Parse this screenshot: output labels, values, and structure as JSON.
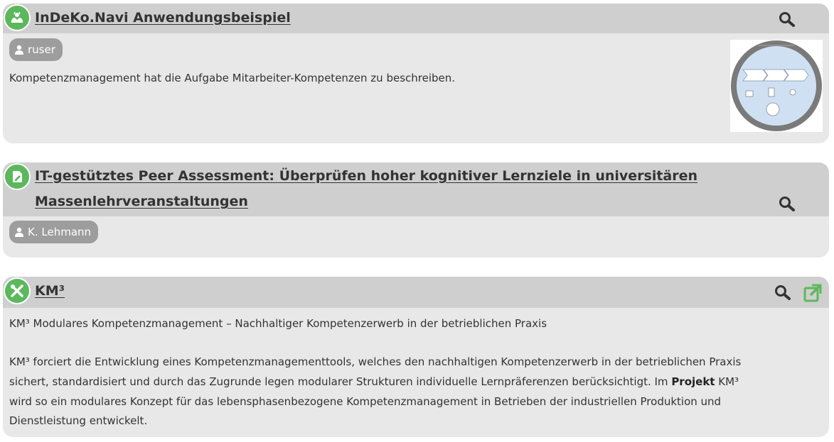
{
  "entries": [
    {
      "title": "InDeKo.Navi Anwendungsbeispiel",
      "author": "ruser",
      "description": "Kompetenzmanagement hat die Aufgabe Mitarbeiter-Kompetenzen zu beschreiben.",
      "type_icon": "hands-icon",
      "actions": [
        "search-icon"
      ],
      "has_thumbnail": true
    },
    {
      "title_line1": "IT-gestütztes Peer Assessment: Überprüfen hoher kognitiver Lernziele in universitären",
      "title_line2": "Massenlehrveranstaltungen",
      "author": "K. Lehmann",
      "type_icon": "document-edit-icon",
      "actions": [
        "search-icon"
      ]
    },
    {
      "title": "KM³",
      "summary": "KM³ Modulares Kompetenzmanagement – Nachhaltiger Kompetenzerwerb in der betrieblichen Praxis",
      "body_line1": "KM³ forciert die Entwicklung eines Kompetenzmanagementtools, welches den nachhaltigen Kompetenzerwerb in der betrieblichen Praxis",
      "body_line2_before": "sichert, standardisiert und durch das Zugrunde legen modularer Strukturen individuelle Lernpräferenzen berücksichtigt. Im ",
      "body_line2_bold": "Projekt",
      "body_line2_after": " KM³",
      "body_line3": "wird so ein modulares Konzept für das lebensphasenbezogene Kompetenzmanagement in Betrieben der industriellen Produktion und",
      "body_line4": "Dienstleistung entwickelt.",
      "type_icon": "tools-icon",
      "actions": [
        "search-icon",
        "external-link-icon"
      ]
    }
  ],
  "colors": {
    "card_background": "#e8e8e8",
    "header_background": "#cfcfcf",
    "accent_green": "#5cb85c",
    "author_badge": "#9d9d9d",
    "text": "#333333"
  }
}
